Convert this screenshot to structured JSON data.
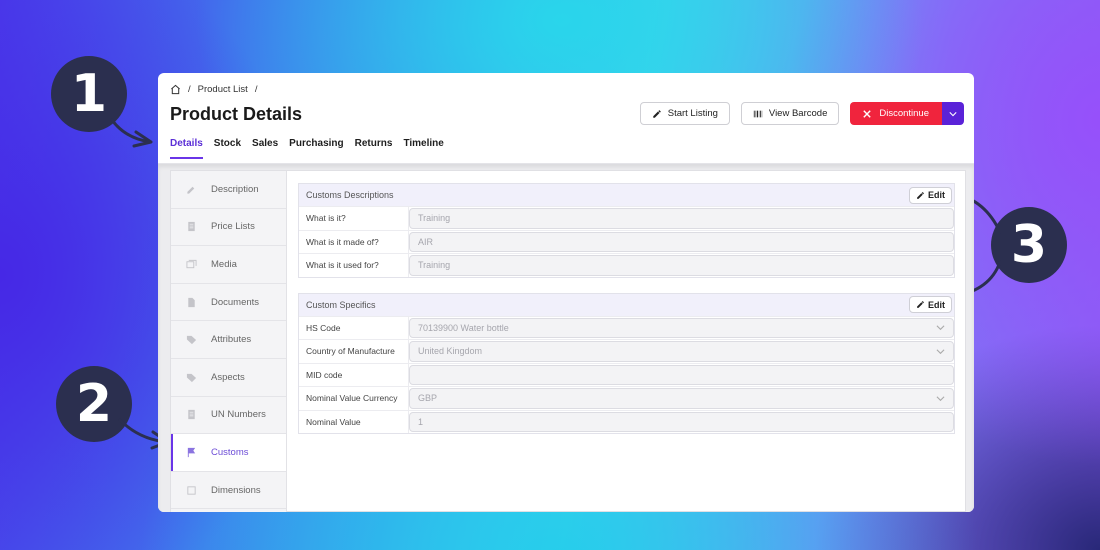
{
  "annotations": {
    "badge1": "1",
    "badge2": "2",
    "badge3": "3"
  },
  "breadcrumb": {
    "home_icon": "home-icon",
    "separator": "/",
    "item": "Product List"
  },
  "page_title": "Product Details",
  "tabs": [
    {
      "label": "Details",
      "active": true
    },
    {
      "label": "Stock"
    },
    {
      "label": "Sales"
    },
    {
      "label": "Purchasing"
    },
    {
      "label": "Returns"
    },
    {
      "label": "Timeline"
    }
  ],
  "toolbar": {
    "start_listing": "Start Listing",
    "view_barcode": "View Barcode",
    "discontinue": "Discontinue"
  },
  "sidebar": {
    "items": [
      {
        "label": "Description",
        "icon": "pencil-icon"
      },
      {
        "label": "Price Lists",
        "icon": "document-icon"
      },
      {
        "label": "Media",
        "icon": "images-icon"
      },
      {
        "label": "Documents",
        "icon": "file-icon"
      },
      {
        "label": "Attributes",
        "icon": "tag-icon"
      },
      {
        "label": "Aspects",
        "icon": "tag-icon"
      },
      {
        "label": "UN Numbers",
        "icon": "document-icon"
      },
      {
        "label": "Customs",
        "icon": "flag-icon",
        "active": true
      },
      {
        "label": "Dimensions",
        "icon": "square-icon"
      }
    ]
  },
  "customs_descriptions": {
    "title": "Customs Descriptions",
    "edit": "Edit",
    "rows": [
      {
        "label": "What is it?",
        "value": "Training"
      },
      {
        "label": "What is it made of?",
        "value": "AIR"
      },
      {
        "label": "What is it used for?",
        "value": "Training"
      }
    ]
  },
  "custom_specifics": {
    "title": "Custom Specifics",
    "edit": "Edit",
    "rows": [
      {
        "label": "HS Code",
        "value": "70139900 Water bottle",
        "dropdown": true
      },
      {
        "label": "Country of Manufacture",
        "value": "United Kingdom",
        "dropdown": true
      },
      {
        "label": "MID code",
        "value": ""
      },
      {
        "label": "Nominal Value Currency",
        "value": "GBP",
        "dropdown": true
      },
      {
        "label": "Nominal Value",
        "value": "1"
      }
    ]
  },
  "colors": {
    "accent": "#6a35e8",
    "danger": "#f0243d",
    "badge": "#2b2f4f"
  }
}
